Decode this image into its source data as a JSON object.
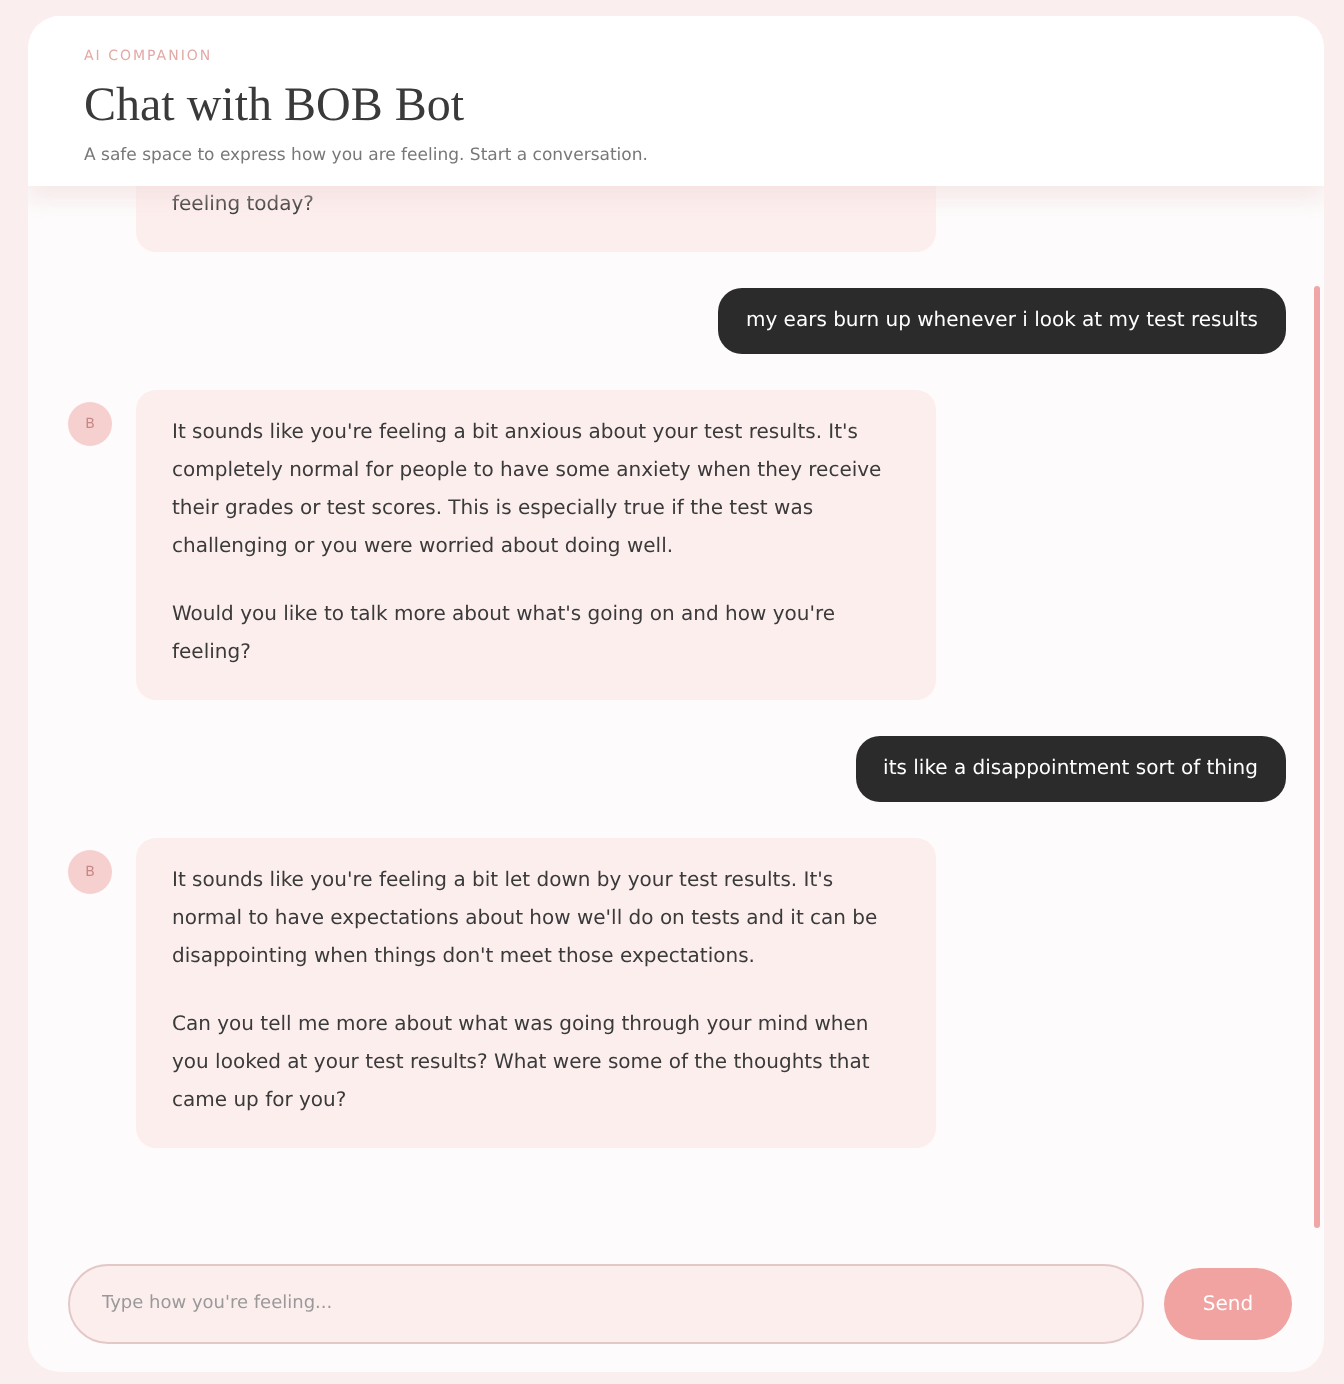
{
  "header": {
    "eyebrow": "AI COMPANION",
    "title": "Chat with BOB Bot",
    "subtitle": "A safe space to express how you are feeling. Start a conversation."
  },
  "messages": [
    {
      "kind": "bot",
      "paragraphs": [
        "feeling today?"
      ]
    },
    {
      "kind": "user",
      "paragraphs": [
        "my ears burn up whenever i look at my test results"
      ]
    },
    {
      "kind": "bot",
      "avatar": "B",
      "paragraphs": [
        "It sounds like you're feeling a bit anxious about your test results. It's completely normal for people to have some anxiety when they receive their grades or test scores. This is especially true if the test was challenging or you were worried about doing well.",
        "Would you like to talk more about what's going on and how you're feeling?"
      ]
    },
    {
      "kind": "user",
      "paragraphs": [
        "its like a disappointment sort of thing"
      ]
    },
    {
      "kind": "bot",
      "avatar": "B",
      "paragraphs": [
        "It sounds like you're feeling a bit let down by your test results. It's normal to have expectations about how we'll do on tests and it can be disappointing when things don't meet those expectations.",
        "Can you tell me more about what was going through your mind when you looked at your test results? What were some of the thoughts that came up for you?"
      ]
    }
  ],
  "composer": {
    "placeholder": "Type how you're feeling...",
    "send": "Send"
  }
}
